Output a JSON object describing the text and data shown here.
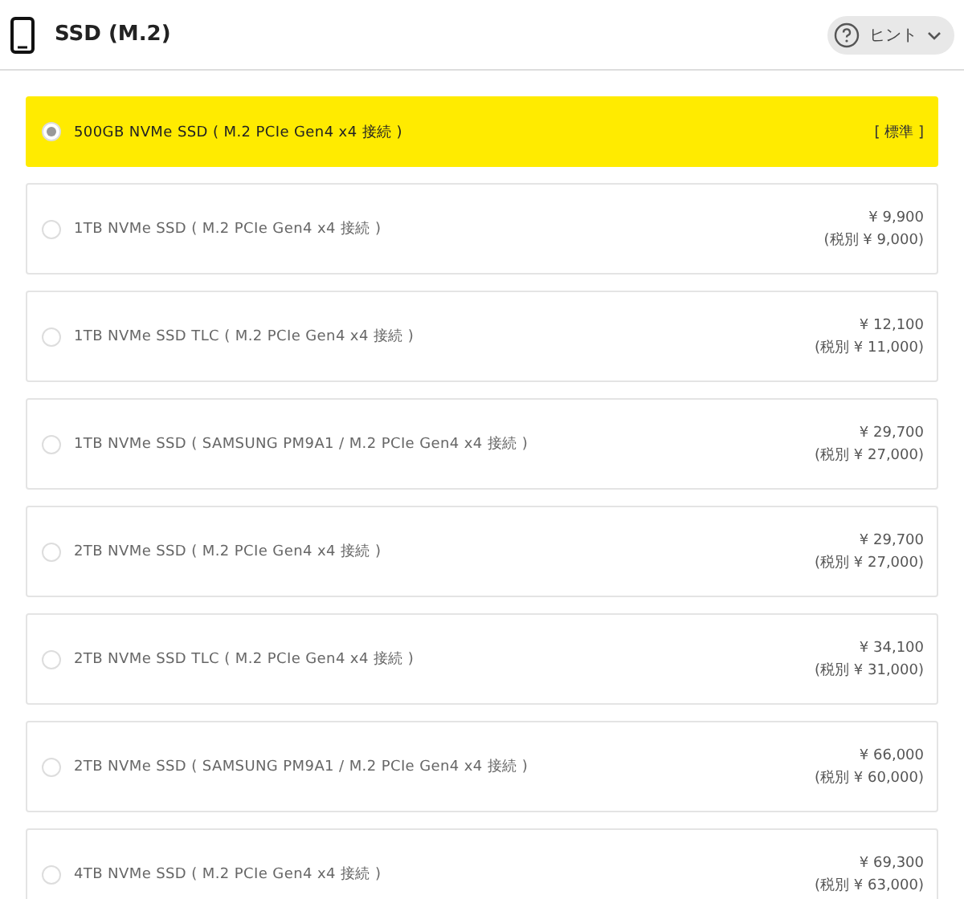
{
  "header": {
    "title": "SSD (M.2)",
    "hint_button": {
      "label": "ヒント",
      "expanded": false
    }
  },
  "options": [
    {
      "label": "500GB NVMe SSD ( M.2 PCIe Gen4 x4 接続 )",
      "selected": true,
      "kind": "standard",
      "badge": "[ 標準 ]"
    },
    {
      "label": "1TB NVMe SSD ( M.2 PCIe Gen4 x4 接続 )",
      "selected": false,
      "kind": "priced",
      "price": "¥ 9,900",
      "price_ex_tax": "(税別 ¥ 9,000)"
    },
    {
      "label": "1TB NVMe SSD TLC ( M.2 PCIe Gen4 x4 接続 )",
      "selected": false,
      "kind": "priced",
      "price": "¥ 12,100",
      "price_ex_tax": "(税別 ¥ 11,000)"
    },
    {
      "label": "1TB NVMe SSD ( SAMSUNG PM9A1 / M.2 PCIe Gen4 x4 接続 )",
      "selected": false,
      "kind": "priced",
      "price": "¥ 29,700",
      "price_ex_tax": "(税別 ¥ 27,000)"
    },
    {
      "label": "2TB NVMe SSD ( M.2 PCIe Gen4 x4 接続 )",
      "selected": false,
      "kind": "priced",
      "price": "¥ 29,700",
      "price_ex_tax": "(税別 ¥ 27,000)"
    },
    {
      "label": "2TB NVMe SSD TLC ( M.2 PCIe Gen4 x4 接続 )",
      "selected": false,
      "kind": "priced",
      "price": "¥ 34,100",
      "price_ex_tax": "(税別 ¥ 31,000)"
    },
    {
      "label": "2TB NVMe SSD ( SAMSUNG PM9A1 / M.2 PCIe Gen4 x4 接続 )",
      "selected": false,
      "kind": "priced",
      "price": "¥ 66,000",
      "price_ex_tax": "(税別 ¥ 60,000)"
    },
    {
      "label": "4TB NVMe SSD ( M.2 PCIe Gen4 x4 接続 )",
      "selected": false,
      "kind": "priced",
      "price": "¥ 69,300",
      "price_ex_tax": "(税別 ¥ 63,000)"
    }
  ]
}
